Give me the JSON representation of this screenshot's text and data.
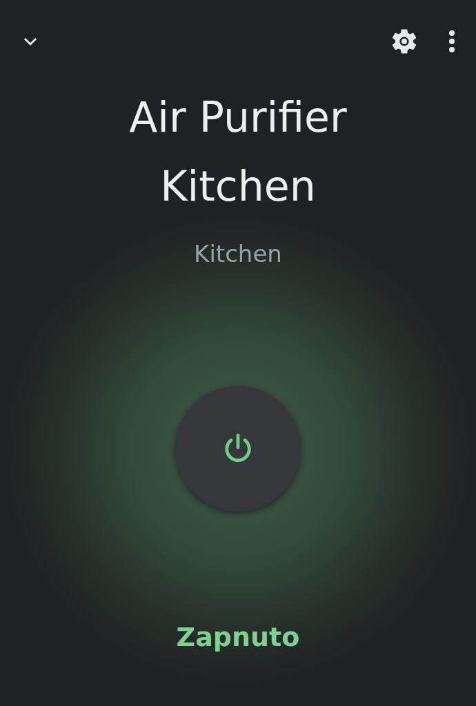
{
  "device": {
    "name": "Air Purifier Kitchen",
    "room": "Kitchen",
    "on": true,
    "status": "Zapnuto"
  }
}
